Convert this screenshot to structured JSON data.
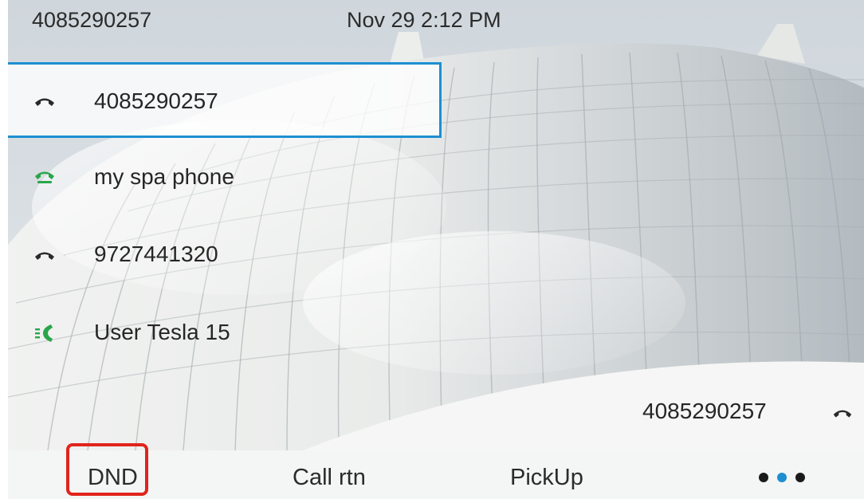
{
  "status_bar": {
    "phone_number": "4085290257",
    "datetime": "Nov 29 2:12 PM"
  },
  "lines": [
    {
      "label": "4085290257",
      "icon": "handset-idle-icon",
      "selected": true
    },
    {
      "label": "my spa phone",
      "icon": "handset-offhook-icon",
      "selected": false
    },
    {
      "label": "9727441320",
      "icon": "handset-idle-icon",
      "selected": false
    },
    {
      "label": "User Tesla 15",
      "icon": "handset-ringing-icon",
      "selected": false
    }
  ],
  "active_call": {
    "number": "4085290257",
    "icon": "handset-idle-icon"
  },
  "softkeys": {
    "dnd": "DND",
    "call_return": "Call rtn",
    "pickup": "PickUp",
    "more_icon": "more-dots-icon"
  },
  "colors": {
    "selection_border": "#1d8fd0",
    "highlight_annotation": "#e0241c",
    "status_green": "#2aa64a",
    "page_indicator_active": "#1d8fd0"
  }
}
